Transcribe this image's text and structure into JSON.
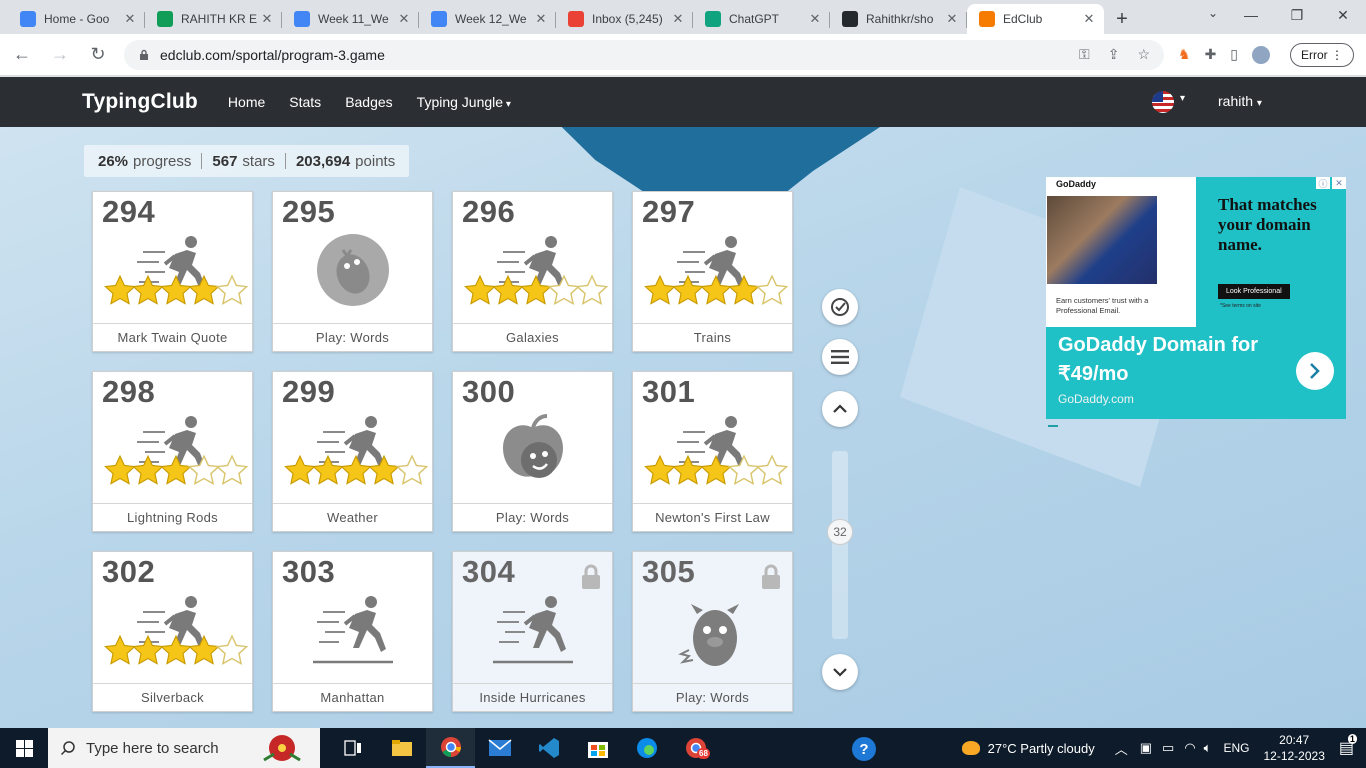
{
  "browser": {
    "tabs": [
      {
        "title": "Home - Goo",
        "color": "#4285f4"
      },
      {
        "title": "RAHITH KR E",
        "color": "#0f9d58"
      },
      {
        "title": "Week 11_We",
        "color": "#4285f4"
      },
      {
        "title": "Week 12_We",
        "color": "#4285f4"
      },
      {
        "title": "Inbox (5,245)",
        "color": "#ea4335"
      },
      {
        "title": "ChatGPT",
        "color": "#10a37f"
      },
      {
        "title": "Rahithkr/sho",
        "color": "#24292e"
      },
      {
        "title": "EdClub",
        "color": "#f57c00"
      }
    ],
    "url": "edclub.com/sportal/program-3.game",
    "error_label": "Error"
  },
  "site": {
    "logo": "TypingClub",
    "nav": [
      "Home",
      "Stats",
      "Badges",
      "Typing Jungle"
    ],
    "user": "rahith"
  },
  "progress": {
    "percent": "26%",
    "percent_label": "progress",
    "stars": "567",
    "stars_label": "stars",
    "points": "203,694",
    "points_label": "points"
  },
  "lessons": [
    {
      "num": "294",
      "label": "Mark Twain Quote",
      "type": "runner",
      "stars": 4,
      "locked": false
    },
    {
      "num": "295",
      "label": "Play: Words",
      "type": "game-chick",
      "stars": 0,
      "locked": false
    },
    {
      "num": "296",
      "label": "Galaxies",
      "type": "runner",
      "stars": 3,
      "locked": false
    },
    {
      "num": "297",
      "label": "Trains",
      "type": "runner",
      "stars": 4,
      "locked": false
    },
    {
      "num": "298",
      "label": "Lightning Rods",
      "type": "runner",
      "stars": 3,
      "locked": false
    },
    {
      "num": "299",
      "label": "Weather",
      "type": "runner",
      "stars": 4,
      "locked": false
    },
    {
      "num": "300",
      "label": "Play: Words",
      "type": "game-apple",
      "stars": 0,
      "locked": false
    },
    {
      "num": "301",
      "label": "Newton's First Law",
      "type": "runner",
      "stars": 3,
      "locked": false
    },
    {
      "num": "302",
      "label": "Silverback",
      "type": "runner",
      "stars": 4,
      "locked": false
    },
    {
      "num": "303",
      "label": "Manhattan",
      "type": "runner-plain",
      "stars": 0,
      "locked": false
    },
    {
      "num": "304",
      "label": "Inside Hurricanes",
      "type": "runner-plain",
      "stars": 0,
      "locked": true
    },
    {
      "num": "305",
      "label": "Play: Words",
      "type": "game-monster",
      "stars": 0,
      "locked": true
    }
  ],
  "scroll": {
    "page": "32"
  },
  "ad": {
    "brand": "GoDaddy",
    "headline": "That matches your domain name.",
    "body": "Earn customers' trust with a Professional Email.",
    "cta": "Look Professional",
    "fine": "*See terms on site",
    "title": "GoDaddy Domain for ₹49/mo",
    "domain": "GoDaddy.com"
  },
  "taskbar": {
    "search_placeholder": "Type here to search",
    "weather": "27°C  Partly cloudy",
    "lang": "ENG",
    "time": "20:47",
    "date": "12-12-2023",
    "badge": "68",
    "notif": "1"
  }
}
